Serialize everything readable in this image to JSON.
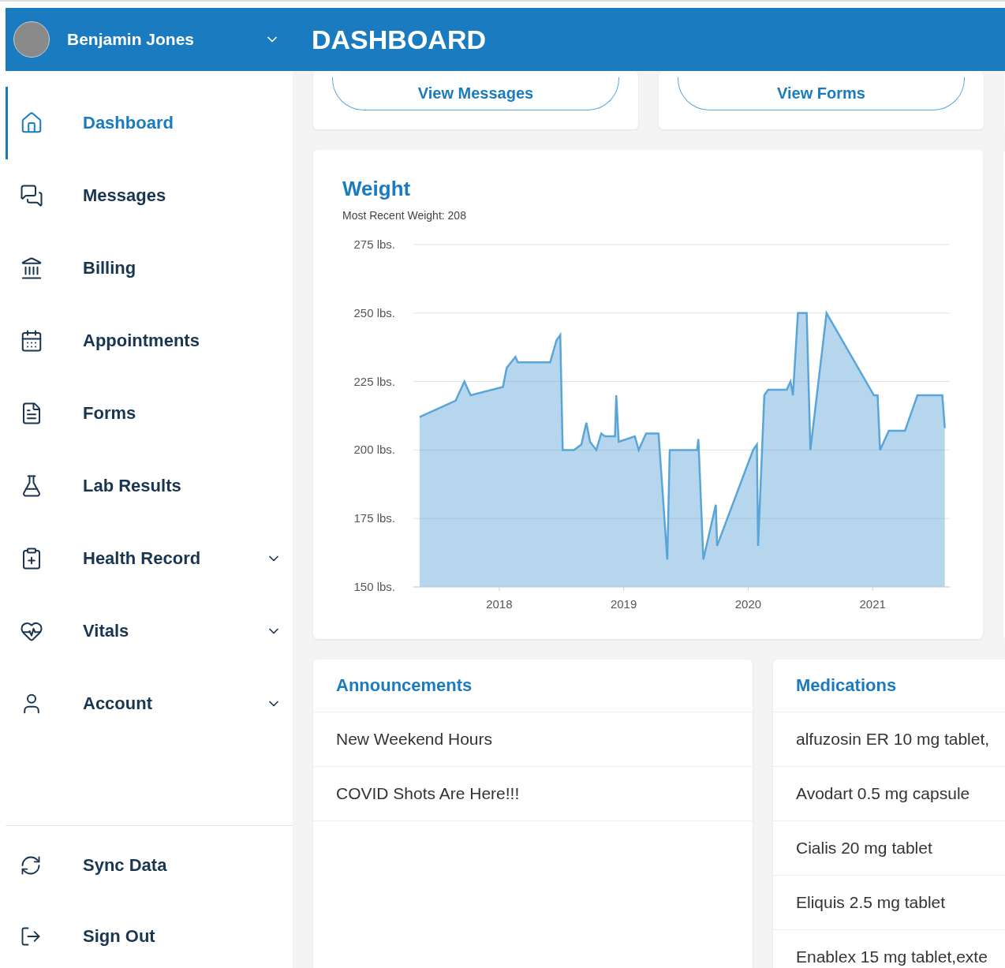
{
  "header": {
    "user_name": "Benjamin Jones",
    "title": "DASHBOARD"
  },
  "sidebar": {
    "items": [
      {
        "label": "Dashboard",
        "selected": true,
        "expandable": false
      },
      {
        "label": "Messages",
        "selected": false,
        "expandable": false
      },
      {
        "label": "Billing",
        "selected": false,
        "expandable": false
      },
      {
        "label": "Appointments",
        "selected": false,
        "expandable": false
      },
      {
        "label": "Forms",
        "selected": false,
        "expandable": false
      },
      {
        "label": "Lab Results",
        "selected": false,
        "expandable": false
      },
      {
        "label": "Health Record",
        "selected": false,
        "expandable": true
      },
      {
        "label": "Vitals",
        "selected": false,
        "expandable": true
      },
      {
        "label": "Account",
        "selected": false,
        "expandable": true
      }
    ],
    "bottom_items": [
      {
        "label": "Sync Data"
      },
      {
        "label": "Sign Out"
      }
    ]
  },
  "quick_links": [
    {
      "label": "View Messages"
    },
    {
      "label": "View Forms"
    }
  ],
  "weight_card": {
    "title": "Weight",
    "subtitle": "Most Recent Weight: 208",
    "chart_data": {
      "type": "area",
      "grid": true,
      "xlim": [
        2017.31,
        2021.62
      ],
      "ylim": [
        150,
        275
      ],
      "xticks": [
        2018,
        2019,
        2020,
        2021
      ],
      "yticks": [
        {
          "value": 150,
          "label": "150 lbs."
        },
        {
          "value": 175,
          "label": "175 lbs."
        },
        {
          "value": 200,
          "label": "200 lbs."
        },
        {
          "value": 225,
          "label": "225 lbs."
        },
        {
          "value": 250,
          "label": "250 lbs."
        },
        {
          "value": 275,
          "label": "275 lbs."
        }
      ],
      "x": [
        2017.36,
        2017.65,
        2017.72,
        2017.77,
        2018.03,
        2018.06,
        2018.13,
        2018.15,
        2018.41,
        2018.46,
        2018.49,
        2018.51,
        2018.6,
        2018.66,
        2018.7,
        2018.73,
        2018.78,
        2018.82,
        2018.85,
        2018.93,
        2018.94,
        2018.96,
        2019.09,
        2019.12,
        2019.18,
        2019.28,
        2019.35,
        2019.37,
        2019.59,
        2019.6,
        2019.64,
        2019.74,
        2019.75,
        2020.04,
        2020.07,
        2020.08,
        2020.13,
        2020.16,
        2020.31,
        2020.34,
        2020.36,
        2020.4,
        2020.47,
        2020.5,
        2020.63,
        2021.01,
        2021.04,
        2021.06,
        2021.13,
        2021.26,
        2021.36,
        2021.56,
        2021.58
      ],
      "series": [
        {
          "color": "#5aa5d8",
          "values": [
            212,
            218,
            225,
            220,
            223,
            230,
            234,
            232,
            232,
            240,
            242,
            200,
            200,
            202,
            210,
            203,
            200,
            206,
            205,
            205,
            220,
            203,
            205,
            200,
            206,
            206,
            160,
            200,
            200,
            204,
            160,
            180,
            165,
            200,
            202,
            165,
            220,
            222,
            222,
            225,
            220,
            250,
            250,
            200,
            250,
            220,
            220,
            200,
            207,
            207,
            220,
            220,
            208
          ]
        }
      ]
    }
  },
  "announcements": {
    "title": "Announcements",
    "items": [
      "New Weekend Hours",
      "COVID Shots Are Here!!!"
    ]
  },
  "medications": {
    "title": "Medications",
    "items": [
      "alfuzosin ER 10 mg tablet,",
      "Avodart 0.5 mg capsule",
      "Cialis 20 mg tablet",
      "Eliquis 2.5 mg tablet",
      "Enablex 15 mg tablet,exte"
    ]
  }
}
